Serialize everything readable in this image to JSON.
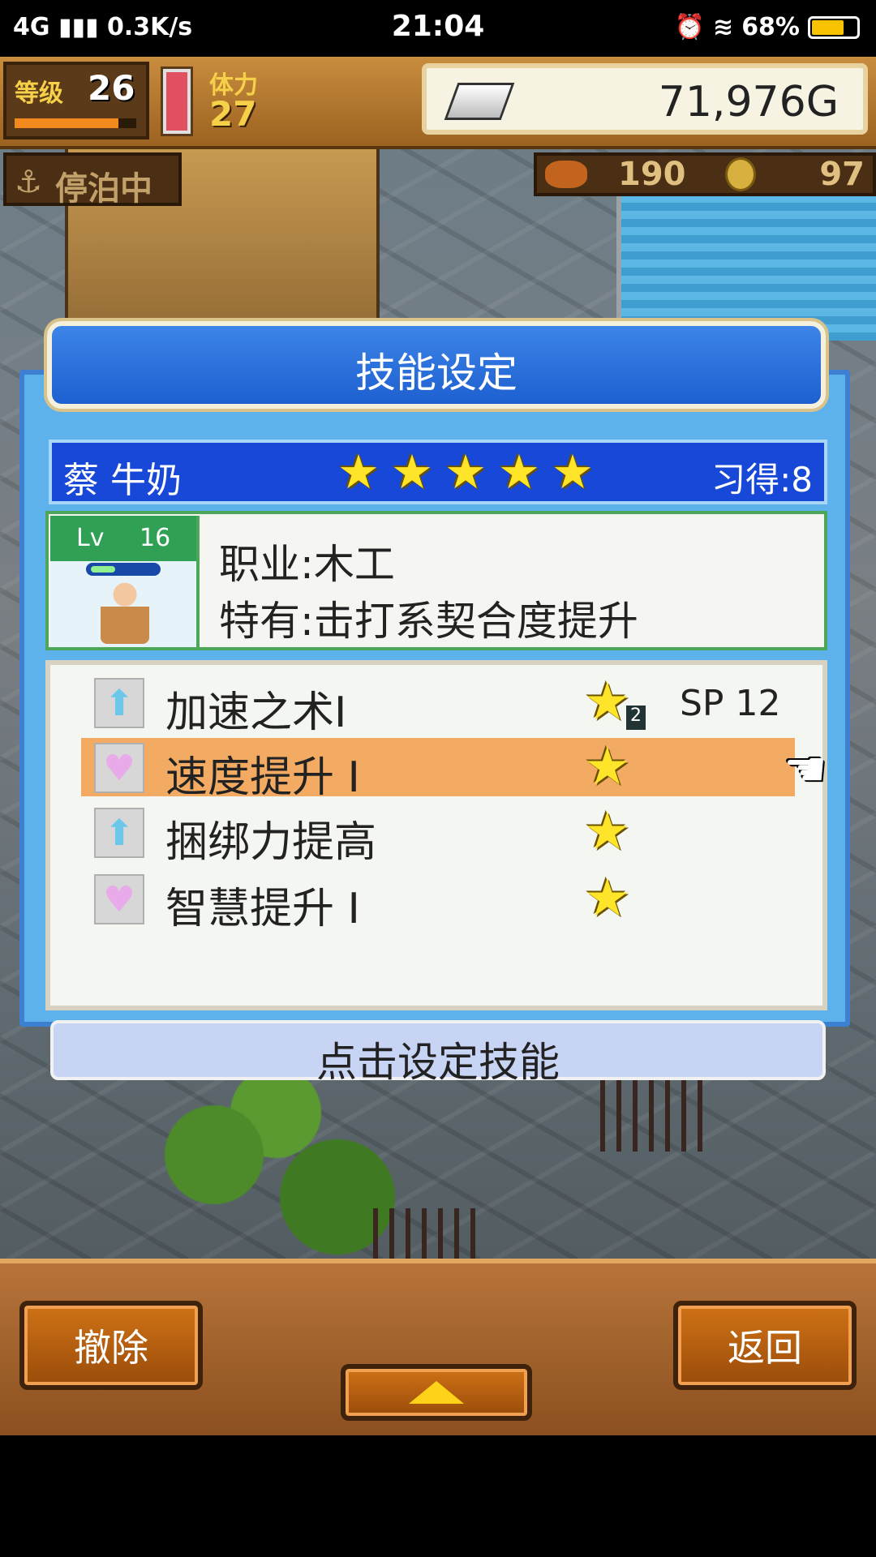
{
  "status_bar": {
    "network": "4G",
    "speed": "0.3K/s",
    "time": "21:04",
    "battery": "68%"
  },
  "hud": {
    "level_label": "等级",
    "level": "26",
    "stamina_label": "体力",
    "stamina": "27",
    "gold": "71,976G",
    "dock_status": "停泊中",
    "food": "190",
    "coins": "97"
  },
  "dialog": {
    "title": "技能设定",
    "character_name": "蔡 牛奶",
    "rank_stars": 5,
    "learned": "习得:8",
    "portrait_lv_label": "Lv",
    "portrait_lv": "16",
    "job": "职业:木工",
    "special": "特有:击打系契合度提升",
    "skills": [
      {
        "name": "加速之术I",
        "icon": "arrow-up-icon",
        "star_badge": "2",
        "sp": "SP 12",
        "selected": false
      },
      {
        "name": "速度提升 I",
        "icon": "heart-icon",
        "star_badge": "",
        "sp": "",
        "selected": true
      },
      {
        "name": "捆绑力提高",
        "icon": "arrow-up-icon",
        "star_badge": "",
        "sp": "",
        "selected": false
      },
      {
        "name": "智慧提升 I",
        "icon": "heart-icon",
        "star_badge": "",
        "sp": "",
        "selected": false
      }
    ],
    "hint": "点击设定技能"
  },
  "bottom": {
    "cancel": "撤除",
    "back": "返回"
  },
  "colors": {
    "dialog_blue": "#1848d8",
    "selected_row": "#f3ab63",
    "star_yellow": "#ffe52a"
  }
}
